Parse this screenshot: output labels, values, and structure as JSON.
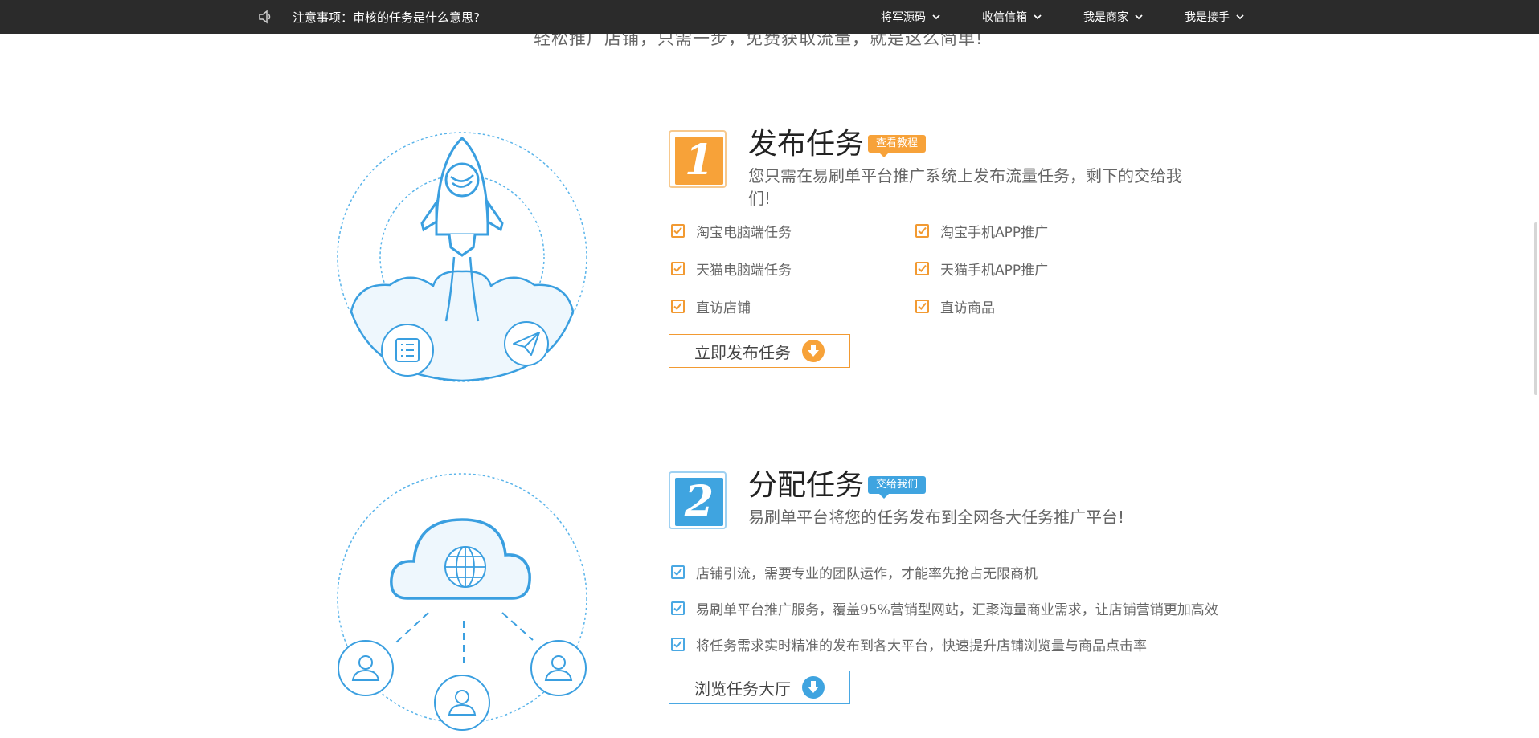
{
  "topbar": {
    "notice": "注意事项：审核的任务是什么意思?",
    "nav": [
      {
        "label": "将军源码"
      },
      {
        "label": "收信信箱"
      },
      {
        "label": "我是商家"
      },
      {
        "label": "我是接手"
      }
    ]
  },
  "headline": "轻松推广店铺，只需一步，免费获取流量，就是这么简单!",
  "step1": {
    "number": "1",
    "title": "发布任务",
    "tag": "查看教程",
    "desc_line1": "您只需在易刷单平台推广系统上发布流量任务，剩下的交给我",
    "desc_line2": "们!",
    "items": [
      "淘宝电脑端任务",
      "淘宝手机APP推广",
      "天猫电脑端任务",
      "天猫手机APP推广",
      "直访店铺",
      "直访商品"
    ],
    "button": "立即发布任务"
  },
  "step2": {
    "number": "2",
    "title": "分配任务",
    "tag": "交给我们",
    "desc": "易刷单平台将您的任务发布到全网各大任务推广平台!",
    "items": [
      "店铺引流，需要专业的团队运作，才能率先抢占无限商机",
      "易刷单平台推广服务，覆盖95%营销型网站，汇聚海量商业需求，让店铺营销更加高效",
      "将任务需求实时精准的发布到各大平台，快速提升店铺浏览量与商品点击率"
    ],
    "button": "浏览任务大厅"
  },
  "colors": {
    "orange": "#f7a239",
    "blue": "#3fa4e0",
    "topbar": "#2b2b2b"
  }
}
